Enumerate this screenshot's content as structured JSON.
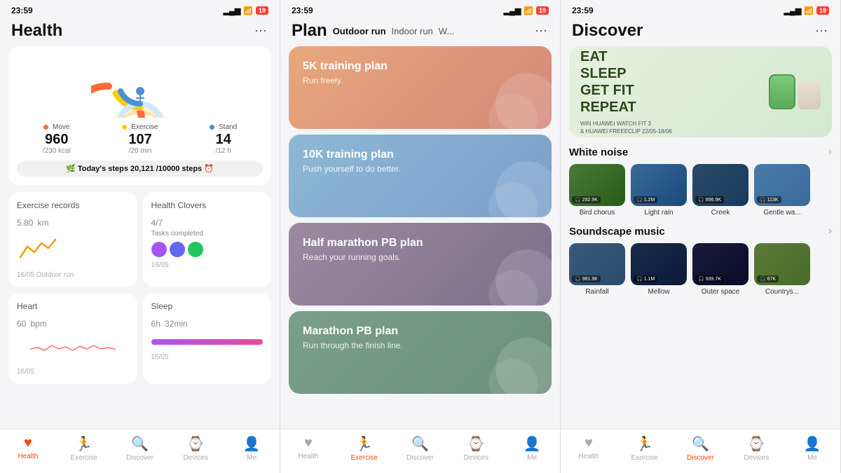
{
  "screen1": {
    "statusBar": {
      "time": "23:59",
      "battery": "19"
    },
    "title": "Health",
    "moreLabel": "⋯",
    "activity": {
      "moveLabel": "Move",
      "moveValue": "960",
      "moveSub": "/230 kcal",
      "moveColor": "#ff6b35",
      "exerciseLabel": "Exercise",
      "exerciseValue": "107",
      "exerciseSub": "/20 min",
      "exerciseColor": "#ffcc00",
      "standLabel": "Stand",
      "standValue": "14",
      "standSub": "/12 h",
      "standColor": "#4a90d9"
    },
    "steps": {
      "label": "🌿 Today's steps",
      "value": "20,121",
      "goal": "/10000 steps"
    },
    "exerciseRecord": {
      "title": "Exercise records",
      "value": "5.80",
      "unit": "km",
      "date": "16/05 Outdoor run"
    },
    "healthClovers": {
      "title": "Health Clovers",
      "value": "4/7",
      "sub": "Tasks completed",
      "date": "16/05"
    },
    "heart": {
      "title": "Heart",
      "value": "60",
      "unit": "bpm",
      "date": "16/05"
    },
    "sleep": {
      "title": "Sleep",
      "hours": "6",
      "mins": "32",
      "unit_h": "h",
      "unit_min": "min",
      "date": "16/05"
    },
    "nav": {
      "items": [
        {
          "icon": "❤️",
          "label": "Health",
          "active": true
        },
        {
          "icon": "🏃",
          "label": "Exercise",
          "active": false
        },
        {
          "icon": "🔍",
          "label": "Discover",
          "active": false
        },
        {
          "icon": "⌚",
          "label": "Devices",
          "active": false
        },
        {
          "icon": "👤",
          "label": "Me",
          "active": false
        }
      ]
    }
  },
  "screen2": {
    "statusBar": {
      "time": "23:59",
      "battery": "19"
    },
    "title": "Plan",
    "tabs": [
      {
        "label": "Outdoor run",
        "active": true
      },
      {
        "label": "Indoor run",
        "active": false
      },
      {
        "label": "W...",
        "active": false
      }
    ],
    "moreLabel": "⋯",
    "plans": [
      {
        "title": "5K training plan",
        "desc": "Run freely.",
        "colorClass": "plan-card-1"
      },
      {
        "title": "10K training plan",
        "desc": "Push yourself to do better.",
        "colorClass": "plan-card-2"
      },
      {
        "title": "Half marathon PB plan",
        "desc": "Reach your running goals.",
        "colorClass": "plan-card-3"
      },
      {
        "title": "Marathon PB plan",
        "desc": "Run through the finish line.",
        "colorClass": "plan-card-4"
      }
    ],
    "nav": {
      "items": [
        {
          "icon": "❤️",
          "label": "Health",
          "active": false
        },
        {
          "icon": "🏃",
          "label": "Exercise",
          "active": true
        },
        {
          "icon": "🔍",
          "label": "Discover",
          "active": false
        },
        {
          "icon": "⌚",
          "label": "Devices",
          "active": false
        },
        {
          "icon": "👤",
          "label": "Me",
          "active": false
        }
      ]
    }
  },
  "screen3": {
    "statusBar": {
      "time": "23:59",
      "battery": "19"
    },
    "title": "Discover",
    "moreLabel": "⋯",
    "promoBanner": {
      "mainText": "EAT\nSLEEP\nGET FIT\nREPEAT",
      "sub": "WIN HUAWEI WATCH FIT 3\n& HUAWEI FREEECLIP 22/05-18/06"
    },
    "whiteNoise": {
      "sectionTitle": "White noise",
      "items": [
        {
          "label": "Bird chorus",
          "count": "292.9K",
          "colorClass": "media-thumb-bird"
        },
        {
          "label": "Light rain",
          "count": "1.2M",
          "colorClass": "media-thumb-rain"
        },
        {
          "label": "Creek",
          "count": "896.9K",
          "colorClass": "media-thumb-creek"
        },
        {
          "label": "Gentle wa...",
          "count": "113K",
          "colorClass": "media-thumb-gentle"
        }
      ]
    },
    "soundscape": {
      "sectionTitle": "Soundscape music",
      "items": [
        {
          "label": "Rainfall",
          "count": "981.9K",
          "colorClass": "media-thumb-rainfall"
        },
        {
          "label": "Mellow",
          "count": "1.1M",
          "colorClass": "media-thumb-mellow"
        },
        {
          "label": "Outer space",
          "count": "939.7K",
          "colorClass": "media-thumb-space"
        },
        {
          "label": "Countrys...",
          "count": "67K",
          "colorClass": "media-thumb-country"
        }
      ]
    },
    "nav": {
      "items": [
        {
          "icon": "❤️",
          "label": "Health",
          "active": false
        },
        {
          "icon": "🏃",
          "label": "Exercise",
          "active": false
        },
        {
          "icon": "🔍",
          "label": "Discover",
          "active": true
        },
        {
          "icon": "⌚",
          "label": "Devices",
          "active": false
        },
        {
          "icon": "👤",
          "label": "Me",
          "active": false
        }
      ]
    }
  }
}
